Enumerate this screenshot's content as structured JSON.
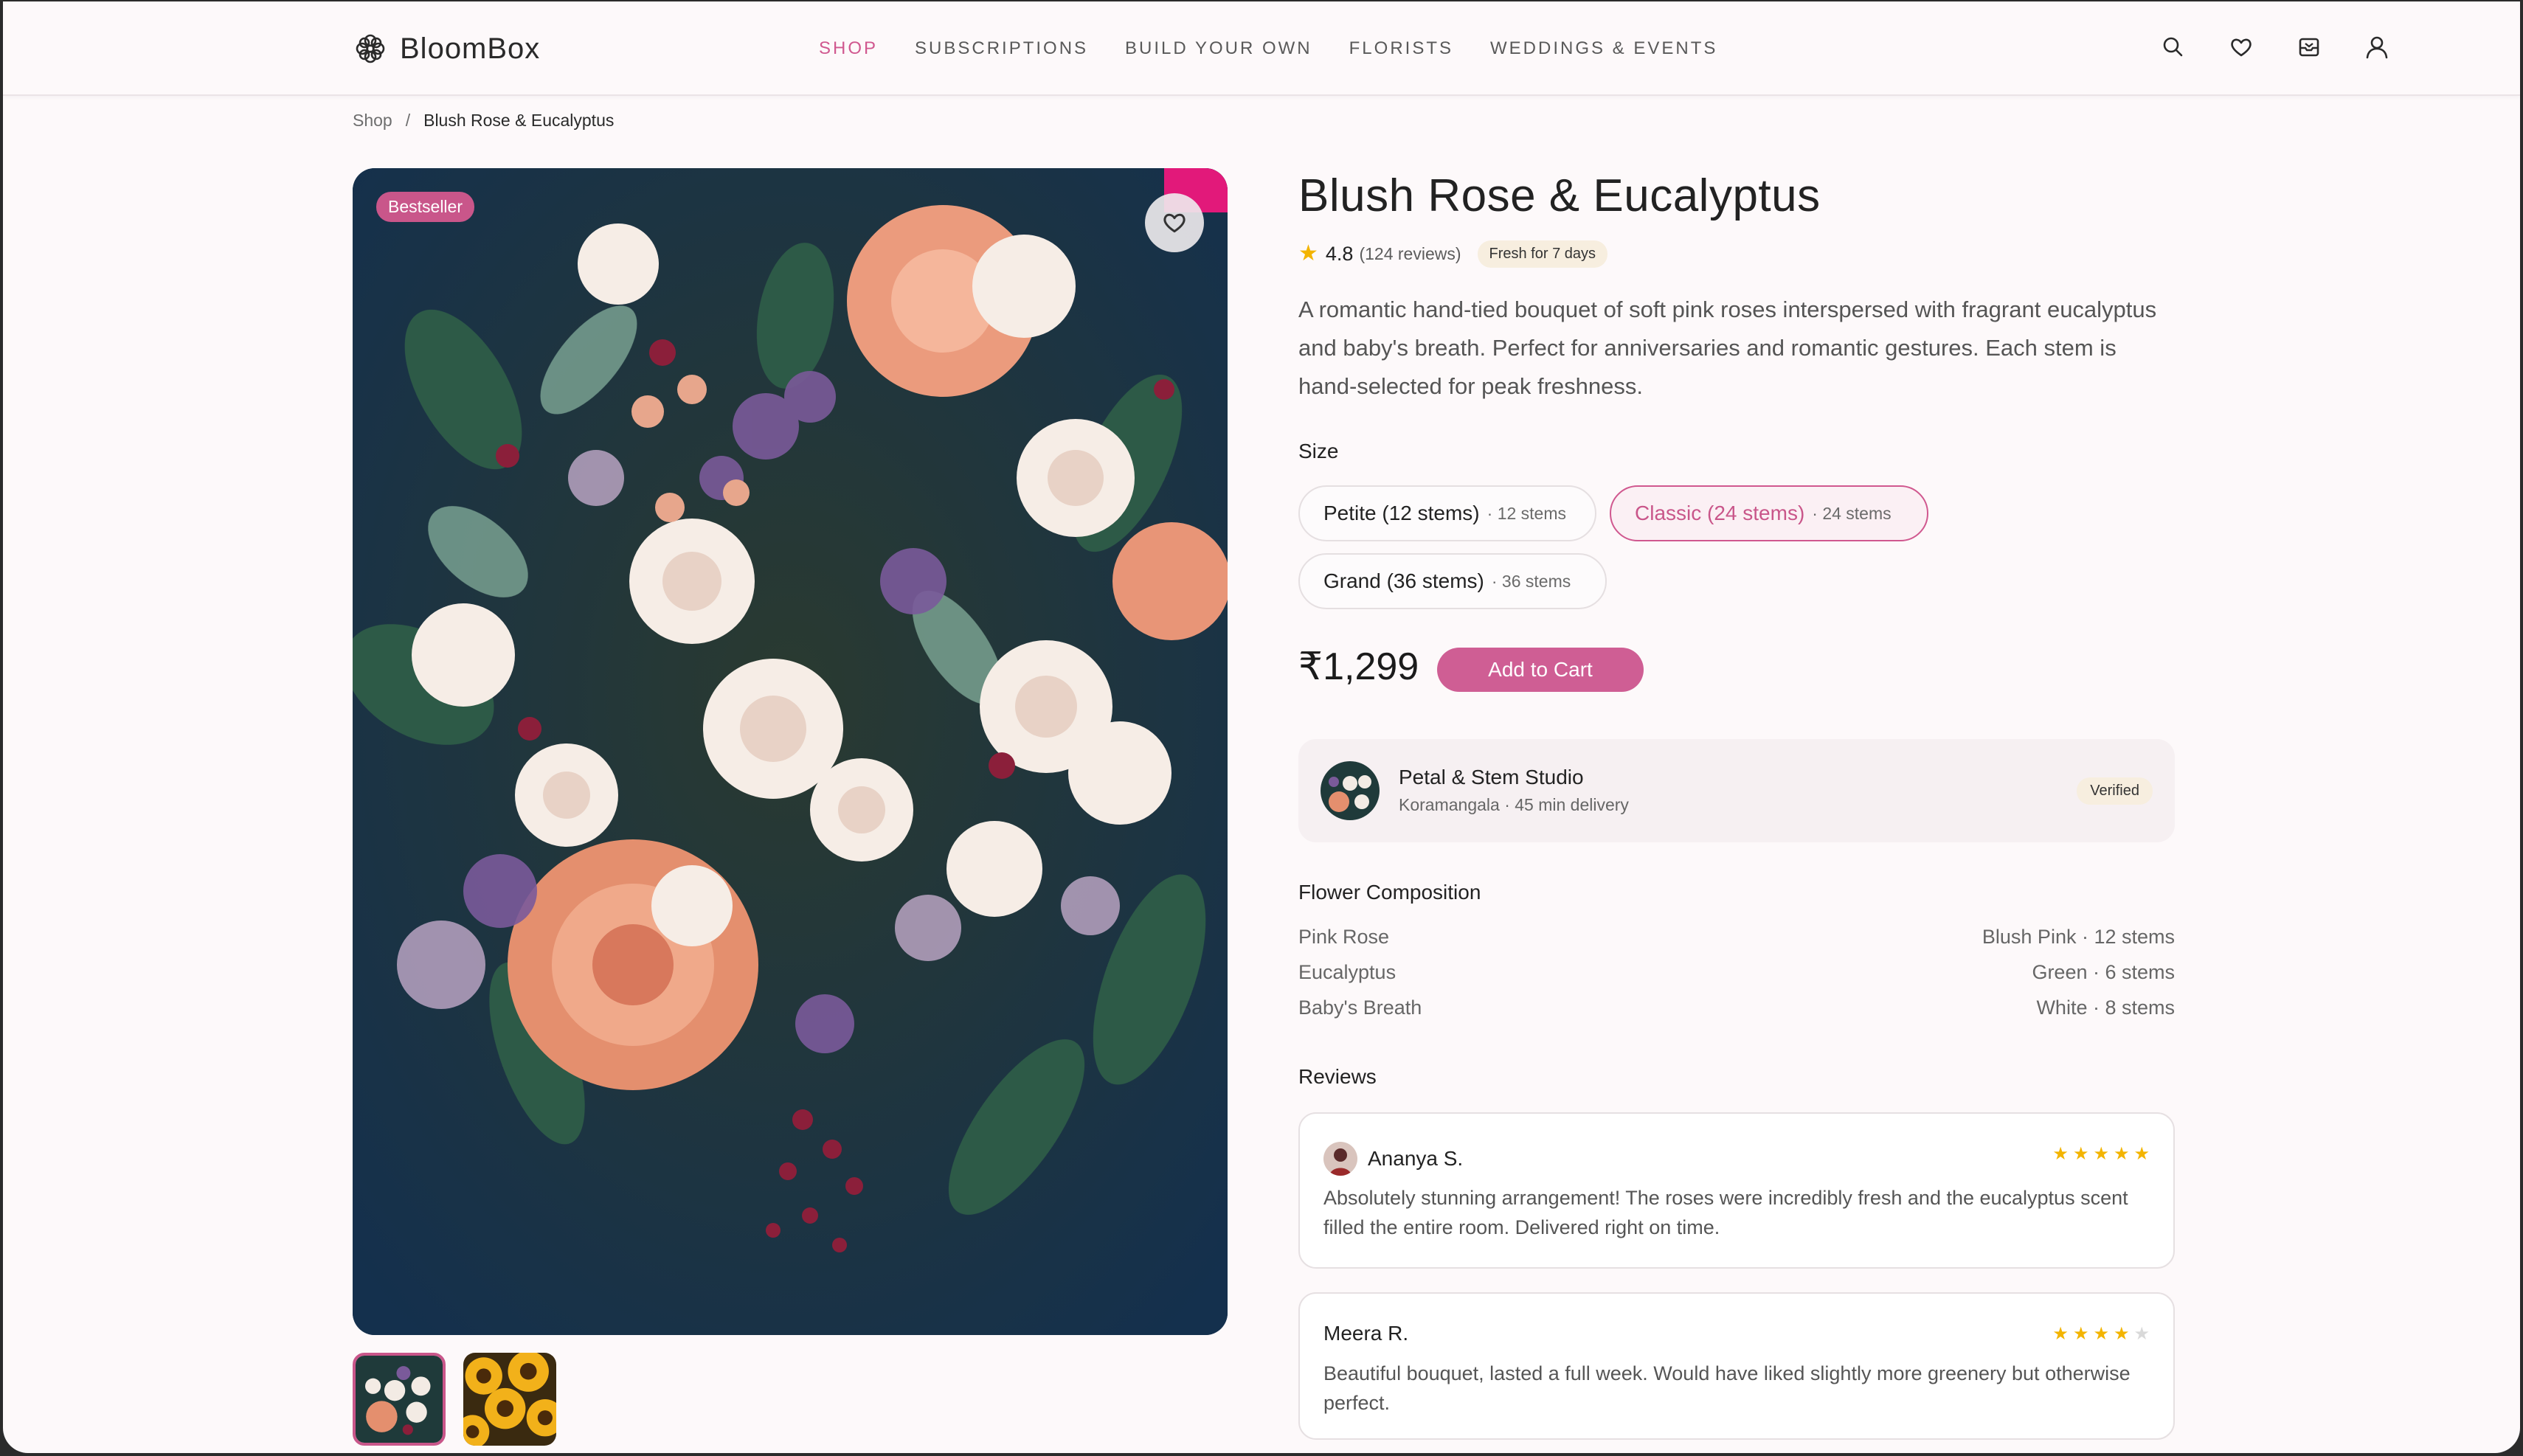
{
  "app": {
    "name": "BloomBox"
  },
  "nav": [
    {
      "label": "SHOP",
      "active": true
    },
    {
      "label": "SUBSCRIPTIONS",
      "active": false
    },
    {
      "label": "BUILD YOUR OWN",
      "active": false
    },
    {
      "label": "FLORISTS",
      "active": false
    },
    {
      "label": "WEDDINGS & EVENTS",
      "active": false
    }
  ],
  "header_icons": [
    "search-icon",
    "heart-icon",
    "inbox-icon",
    "user-icon"
  ],
  "breadcrumb": {
    "root": "Shop",
    "sep": "/",
    "current": "Blush Rose & Eucalyptus"
  },
  "product": {
    "badge": "Bestseller",
    "title": "Blush Rose & Eucalyptus",
    "rating": "4.8",
    "reviews_count": "(124 reviews)",
    "fresh_badge": "Fresh for 7 days",
    "description": "A romantic hand-tied bouquet of soft pink roses interspersed with fragrant eucalyptus and baby's breath. Perfect for anniversaries and romantic gestures. Each stem is hand-selected for peak freshness.",
    "size_label": "Size",
    "sizes": [
      {
        "name": "Petite (12 stems)",
        "stems": "· 12 stems",
        "selected": false
      },
      {
        "name": "Classic (24 stems)",
        "stems": "· 24 stems",
        "selected": true
      },
      {
        "name": "Grand (36 stems)",
        "stems": "· 36 stems",
        "selected": false
      }
    ],
    "price": "₹1,299",
    "add_to_cart": "Add to Cart"
  },
  "vendor": {
    "name": "Petal & Stem Studio",
    "sub": "Koramangala · 45 min delivery",
    "badge": "Verified"
  },
  "composition": {
    "heading": "Flower Composition",
    "rows": [
      {
        "flower": "Pink Rose",
        "detail": "Blush Pink · 12 stems"
      },
      {
        "flower": "Eucalyptus",
        "detail": "Green · 6 stems"
      },
      {
        "flower": "Baby's Breath",
        "detail": "White · 8 stems"
      }
    ]
  },
  "reviews": {
    "heading": "Reviews",
    "items": [
      {
        "name": "Ananya S.",
        "stars": 5,
        "text": "Absolutely stunning arrangement! The roses were incredibly fresh and the eucalyptus scent filled the entire room. Delivered right on time."
      },
      {
        "name": "Meera R.",
        "stars": 4,
        "text": "Beautiful bouquet, lasted a full week. Would have liked slightly more greenery but otherwise perfect."
      }
    ]
  },
  "colors": {
    "accent": "#d0588f",
    "star": "#f3b400",
    "background": "#fdf9fa"
  }
}
